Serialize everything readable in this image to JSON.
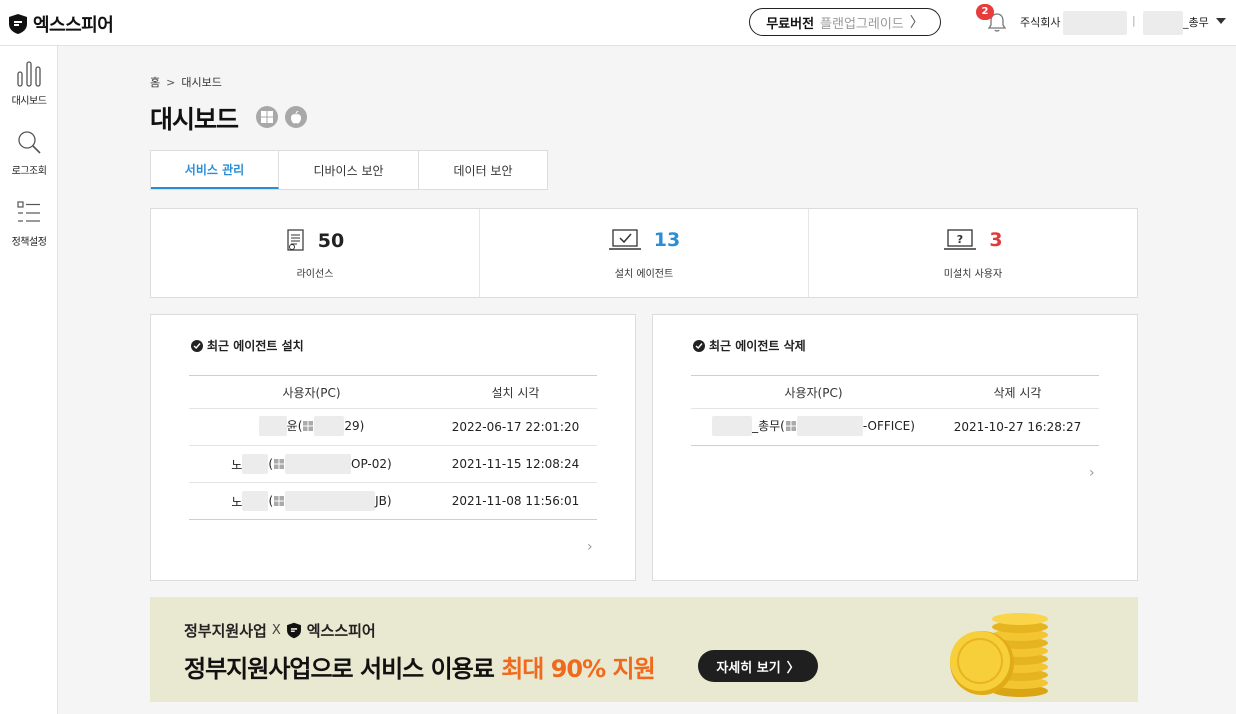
{
  "header": {
    "logo_text": "엑스스피어",
    "upgrade_free": "무료버전",
    "upgrade_plan": "플랜업그레이드",
    "upgrade_chevron": "〉",
    "notification_count": "2",
    "company_prefix": "주식회사",
    "separator": "|",
    "user_suffix": "_총무"
  },
  "sidebar": {
    "items": [
      {
        "label": "대시보드",
        "icon": "bar-chart-icon"
      },
      {
        "label": "로그조회",
        "icon": "search-icon"
      },
      {
        "label": "정책설정",
        "icon": "list-settings-icon"
      }
    ]
  },
  "breadcrumb": {
    "home": "홈",
    "separator": ">",
    "current": "대시보드"
  },
  "page": {
    "title": "대시보드"
  },
  "tabs": [
    {
      "label": "서비스 관리",
      "active": true
    },
    {
      "label": "디바이스 보안",
      "active": false
    },
    {
      "label": "데이터 보안",
      "active": false
    }
  ],
  "stats": [
    {
      "value": "50",
      "label": "라이선스",
      "color": "#222222",
      "icon": "license-document-icon"
    },
    {
      "value": "13",
      "label": "설치 에이전트",
      "color": "#2a8ed6",
      "icon": "laptop-check-icon"
    },
    {
      "value": "3",
      "label": "미설치 사용자",
      "color": "#e23a3a",
      "icon": "laptop-question-icon"
    }
  ],
  "recent_install": {
    "title": "최근 에이전트 설치",
    "columns": [
      "사용자(PC)",
      "설치 시각"
    ],
    "rows": [
      {
        "user_tail": "윤(",
        "pc_tail": "29)",
        "time": "2022-06-17 22:01:20"
      },
      {
        "user_tail": "노",
        "pc_tail": "OP-02)",
        "time": "2021-11-15 12:08:24"
      },
      {
        "user_tail": "노",
        "pc_tail": "JB)",
        "time": "2021-11-08 11:56:01"
      }
    ],
    "more": "›"
  },
  "recent_delete": {
    "title": "최근 에이전트 삭제",
    "columns": [
      "사용자(PC)",
      "삭제 시각"
    ],
    "rows": [
      {
        "user_tail": "_총무(",
        "pc_tail": "-OFFICE)",
        "time": "2021-10-27 16:28:27"
      }
    ],
    "more": "›"
  },
  "banner": {
    "top_text": "정부지원사업",
    "top_x": "X",
    "top_brand": "엑스스피어",
    "main_text": "정부지원사업으로 서비스 이용료 ",
    "highlight": "최대 90% 지원",
    "button": "자세히 보기",
    "button_chevron": "〉"
  }
}
